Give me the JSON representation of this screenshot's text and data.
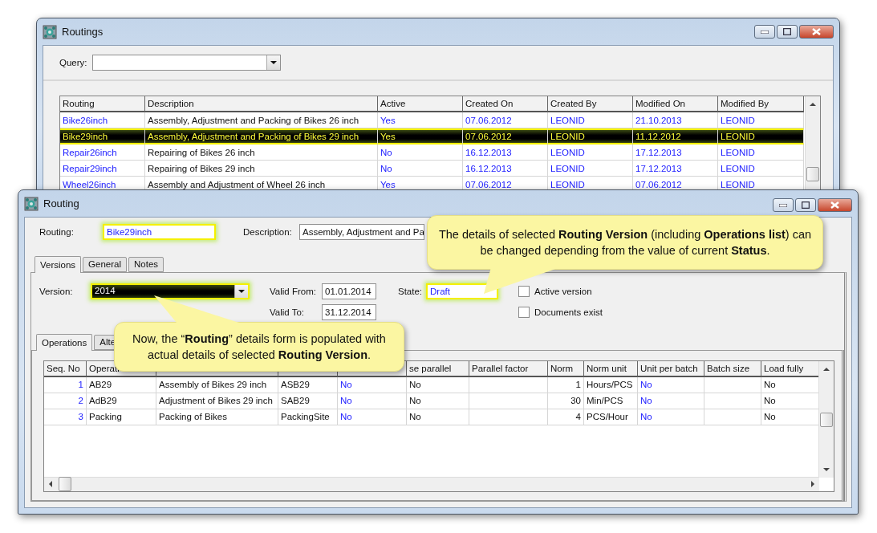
{
  "routings_window": {
    "title": "Routings",
    "query": {
      "label": "Query:"
    },
    "table": {
      "columns": [
        {
          "label": "Routing",
          "kind": "link"
        },
        {
          "label": "Description",
          "kind": "text"
        },
        {
          "label": "Active",
          "kind": "link"
        },
        {
          "label": "Created On",
          "kind": "link"
        },
        {
          "label": "Created By",
          "kind": "link"
        },
        {
          "label": "Modified On",
          "kind": "link"
        },
        {
          "label": "Modified By",
          "kind": "link"
        }
      ],
      "rows": [
        {
          "selected": false,
          "cells": [
            "Bike26inch",
            "Assembly, Adjustment and Packing of Bikes 26 inch",
            "Yes",
            "07.06.2012",
            "LEONID",
            "21.10.2013",
            "LEONID"
          ]
        },
        {
          "selected": true,
          "cells": [
            "Bike29inch",
            "Assembly, Adjustment and Packing of Bikes 29 inch",
            "Yes",
            "07.06.2012",
            "LEONID",
            "11.12.2012",
            "LEONID"
          ]
        },
        {
          "selected": false,
          "cells": [
            "Repair26inch",
            "Repairing of Bikes 26 inch",
            "No",
            "16.12.2013",
            "LEONID",
            "17.12.2013",
            "LEONID"
          ]
        },
        {
          "selected": false,
          "cells": [
            "Repair29inch",
            "Repairing of Bikes 29 inch",
            "No",
            "16.12.2013",
            "LEONID",
            "17.12.2013",
            "LEONID"
          ]
        },
        {
          "selected": false,
          "cells": [
            "Wheel26inch",
            "Assembly and Adjustment of Wheel 26 inch",
            "Yes",
            "07.06.2012",
            "LEONID",
            "07.06.2012",
            "LEONID"
          ]
        }
      ]
    }
  },
  "routing_window": {
    "title": "Routing",
    "fields": [
      {
        "label": "Routing:",
        "value": "Bike29inch",
        "kind": "link",
        "highlighted": true
      },
      {
        "label": "Description:",
        "value": "Assembly, Adjustment and Pa",
        "kind": "text",
        "highlighted": false
      }
    ],
    "tabs": [
      {
        "label": "Versions",
        "selected": true
      },
      {
        "label": "General",
        "selected": false
      },
      {
        "label": "Notes",
        "selected": false
      }
    ],
    "version": {
      "label": "Version:",
      "value": "2014",
      "focused": true,
      "highlighted": true
    },
    "valid_from": {
      "label": "Valid From:",
      "value": "01.01.2014"
    },
    "valid_to": {
      "label": "Valid To:",
      "value": "31.12.2014"
    },
    "state": {
      "label": "State:",
      "value": "Draft",
      "highlighted": true
    },
    "checkboxes": [
      {
        "label": "Active version",
        "checked": false
      },
      {
        "label": "Documents exist",
        "checked": false
      }
    ],
    "sub_tabs": [
      {
        "label": "Operations",
        "selected": true
      },
      {
        "label": "Alte",
        "selected": false
      }
    ],
    "operations_table": {
      "columns": [
        {
          "label": "Seq. No",
          "kind": "number-link"
        },
        {
          "label": "Operati",
          "kind": "text"
        },
        {
          "kind": "text"
        },
        {
          "kind": "text"
        },
        {
          "kind": "link"
        },
        {
          "label": "se parallel",
          "kind": "text"
        },
        {
          "label": "Parallel factor",
          "kind": "text"
        },
        {
          "label": "Norm",
          "kind": "number"
        },
        {
          "label": "Norm unit",
          "kind": "text"
        },
        {
          "label": "Unit per batch",
          "kind": "link"
        },
        {
          "label": "Batch size",
          "kind": "text"
        },
        {
          "label": "Load fully",
          "kind": "text"
        }
      ],
      "rows": [
        {
          "selected": false,
          "cells": [
            "1",
            "AB29",
            "Assembly of Bikes 29 inch",
            "ASB29",
            "No",
            "No",
            null,
            "1",
            "Hours/PCS",
            "No",
            null,
            "No"
          ]
        },
        {
          "selected": false,
          "cells": [
            "2",
            "AdB29",
            "Adjustment of Bikes 29 inch",
            "SAB29",
            "No",
            "No",
            null,
            "30",
            "Min/PCS",
            "No",
            null,
            "No"
          ]
        },
        {
          "selected": false,
          "cells": [
            "3",
            "Packing",
            "Packing of Bikes",
            "PackingSite",
            "No",
            "No",
            null,
            "4",
            "PCS/Hour",
            "No",
            null,
            "No"
          ]
        }
      ]
    }
  },
  "callouts": [
    {
      "text": "The details of selected **Routing Version** (including **Operations list**) can be changed depending from the value of current **Status**."
    },
    {
      "text": "Now, the “**Routing**” details form is populated with actual details of selected **Routing Version**."
    }
  ]
}
